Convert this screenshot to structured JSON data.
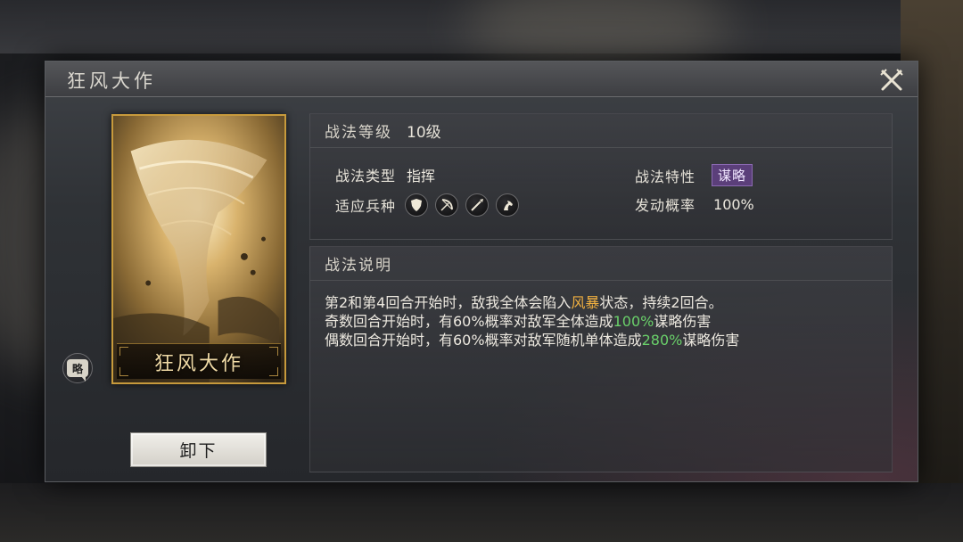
{
  "dialog": {
    "title": "狂风大作"
  },
  "card": {
    "name": "狂风大作",
    "badge_text": "略"
  },
  "buttons": {
    "unequip_label": "卸下"
  },
  "level_panel": {
    "level_label": "战法等级",
    "level_value": "10级",
    "type_label": "战法类型",
    "type_value": "指挥",
    "troops_label": "适应兵种",
    "troops": [
      "shield-icon",
      "bow-icon",
      "spear-icon",
      "horse-icon"
    ],
    "trait_label": "战法特性",
    "trait_value": "谋略",
    "rate_label": "发动概率",
    "rate_value": "100%"
  },
  "desc_panel": {
    "title": "战法说明",
    "line1": {
      "before": "第2和第4回合开始时，敌我全体会陷入",
      "highlight": "风暴",
      "after": "状态，持续2回合。"
    },
    "line2": {
      "before": "奇数回合开始时，有60%概率对敌军全体造成",
      "highlight": "100%",
      "after": "谋略伤害"
    },
    "line3": {
      "before": "偶数回合开始时，有60%概率对敌军随机单体造成",
      "highlight": "280%",
      "after": "谋略伤害"
    }
  },
  "colors": {
    "card_border": "#c79a3c",
    "trait_tag": "#5b3f7a",
    "highlight_orange": "#f0b040",
    "highlight_green": "#6ad06a"
  }
}
